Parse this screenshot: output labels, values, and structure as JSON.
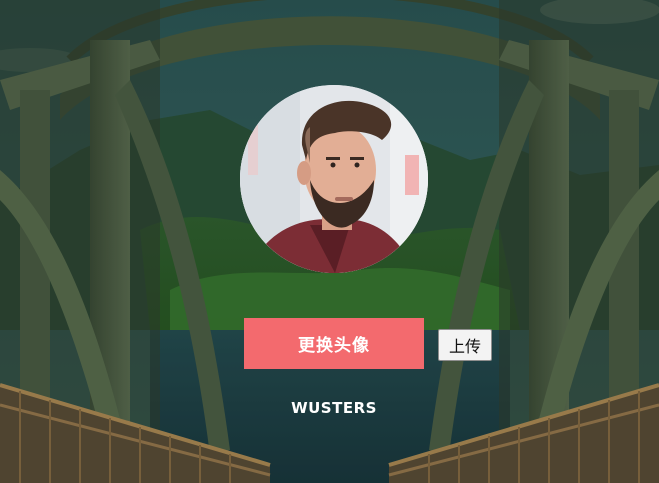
{
  "profile": {
    "change_avatar_label": "更换头像",
    "upload_label": "上传",
    "username": "WUSTERS"
  },
  "colors": {
    "accent": "#f36a6e",
    "upload_button_bg": "#f3f3f3",
    "username_text": "#ffffff"
  },
  "icons": {
    "background": "bridge-background-image",
    "avatar": "user-avatar-photo"
  }
}
